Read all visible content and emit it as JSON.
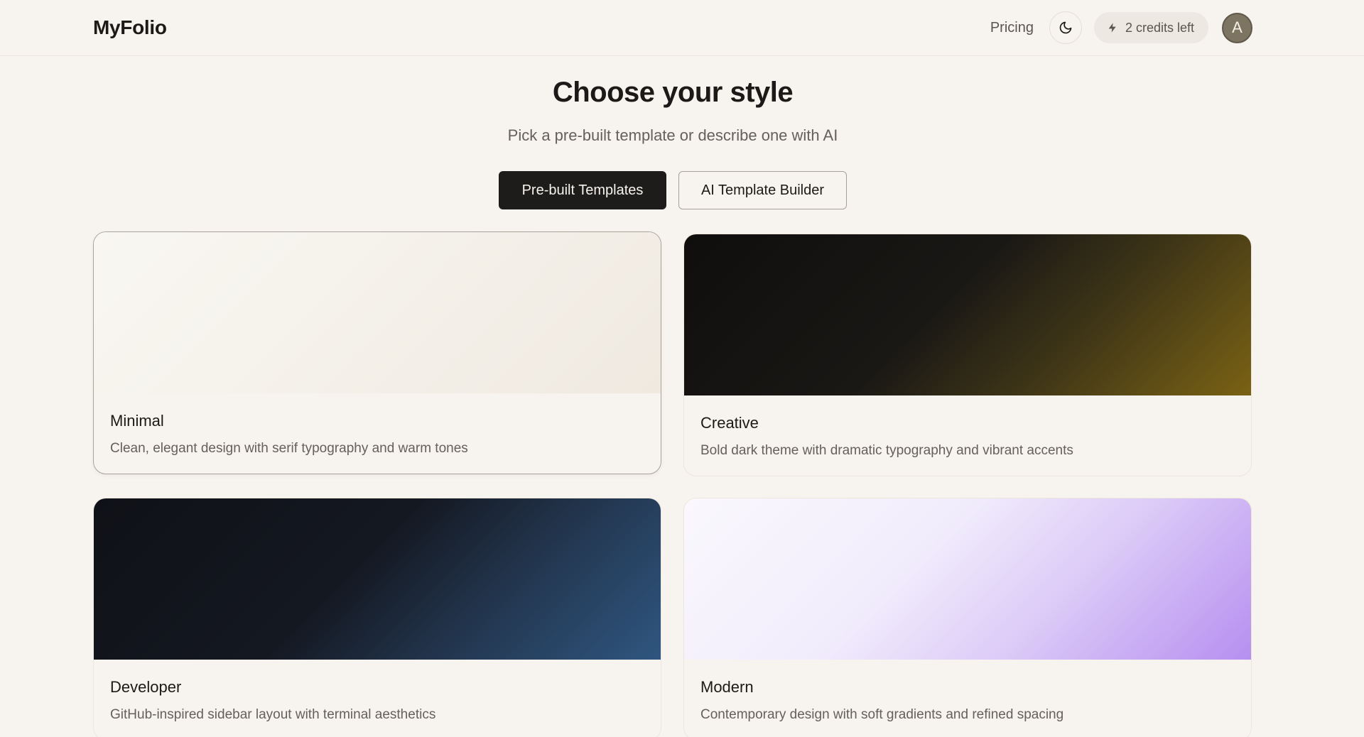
{
  "app": {
    "logo": "MyFolio"
  },
  "header": {
    "pricing_label": "Pricing",
    "theme_toggle_icon": "moon-icon",
    "credits_icon": "bolt-icon",
    "credits_label": "2 credits left",
    "avatar_initial": "A"
  },
  "hero": {
    "title": "Choose your style",
    "subtitle": "Pick a pre-built template or describe one with AI"
  },
  "tabs": [
    {
      "label": "Pre-built Templates",
      "active": true
    },
    {
      "label": "AI Template Builder",
      "active": false
    }
  ],
  "templates": [
    {
      "name": "Minimal",
      "description": "Clean, elegant design with serif typography and warm tones",
      "selected": true,
      "colors": [
        "#f9f7f2",
        "#efe9e0"
      ]
    },
    {
      "name": "Creative",
      "description": "Bold dark theme with dramatic typography and vibrant accents",
      "selected": false,
      "colors": [
        "#100e0d",
        "#7a6214"
      ]
    },
    {
      "name": "Developer",
      "description": "GitHub-inspired sidebar layout with terminal aesthetics",
      "selected": false,
      "colors": [
        "#0f1117",
        "#2f5680"
      ]
    },
    {
      "name": "Modern",
      "description": "Contemporary design with soft gradients and refined spacing",
      "selected": false,
      "colors": [
        "#faf8fd",
        "#b68ff0"
      ]
    }
  ],
  "colors": {
    "background": "#f7f3ee",
    "primary_button": "#1d1c1b",
    "text": "#1c1a18",
    "muted_text": "#66605a"
  }
}
